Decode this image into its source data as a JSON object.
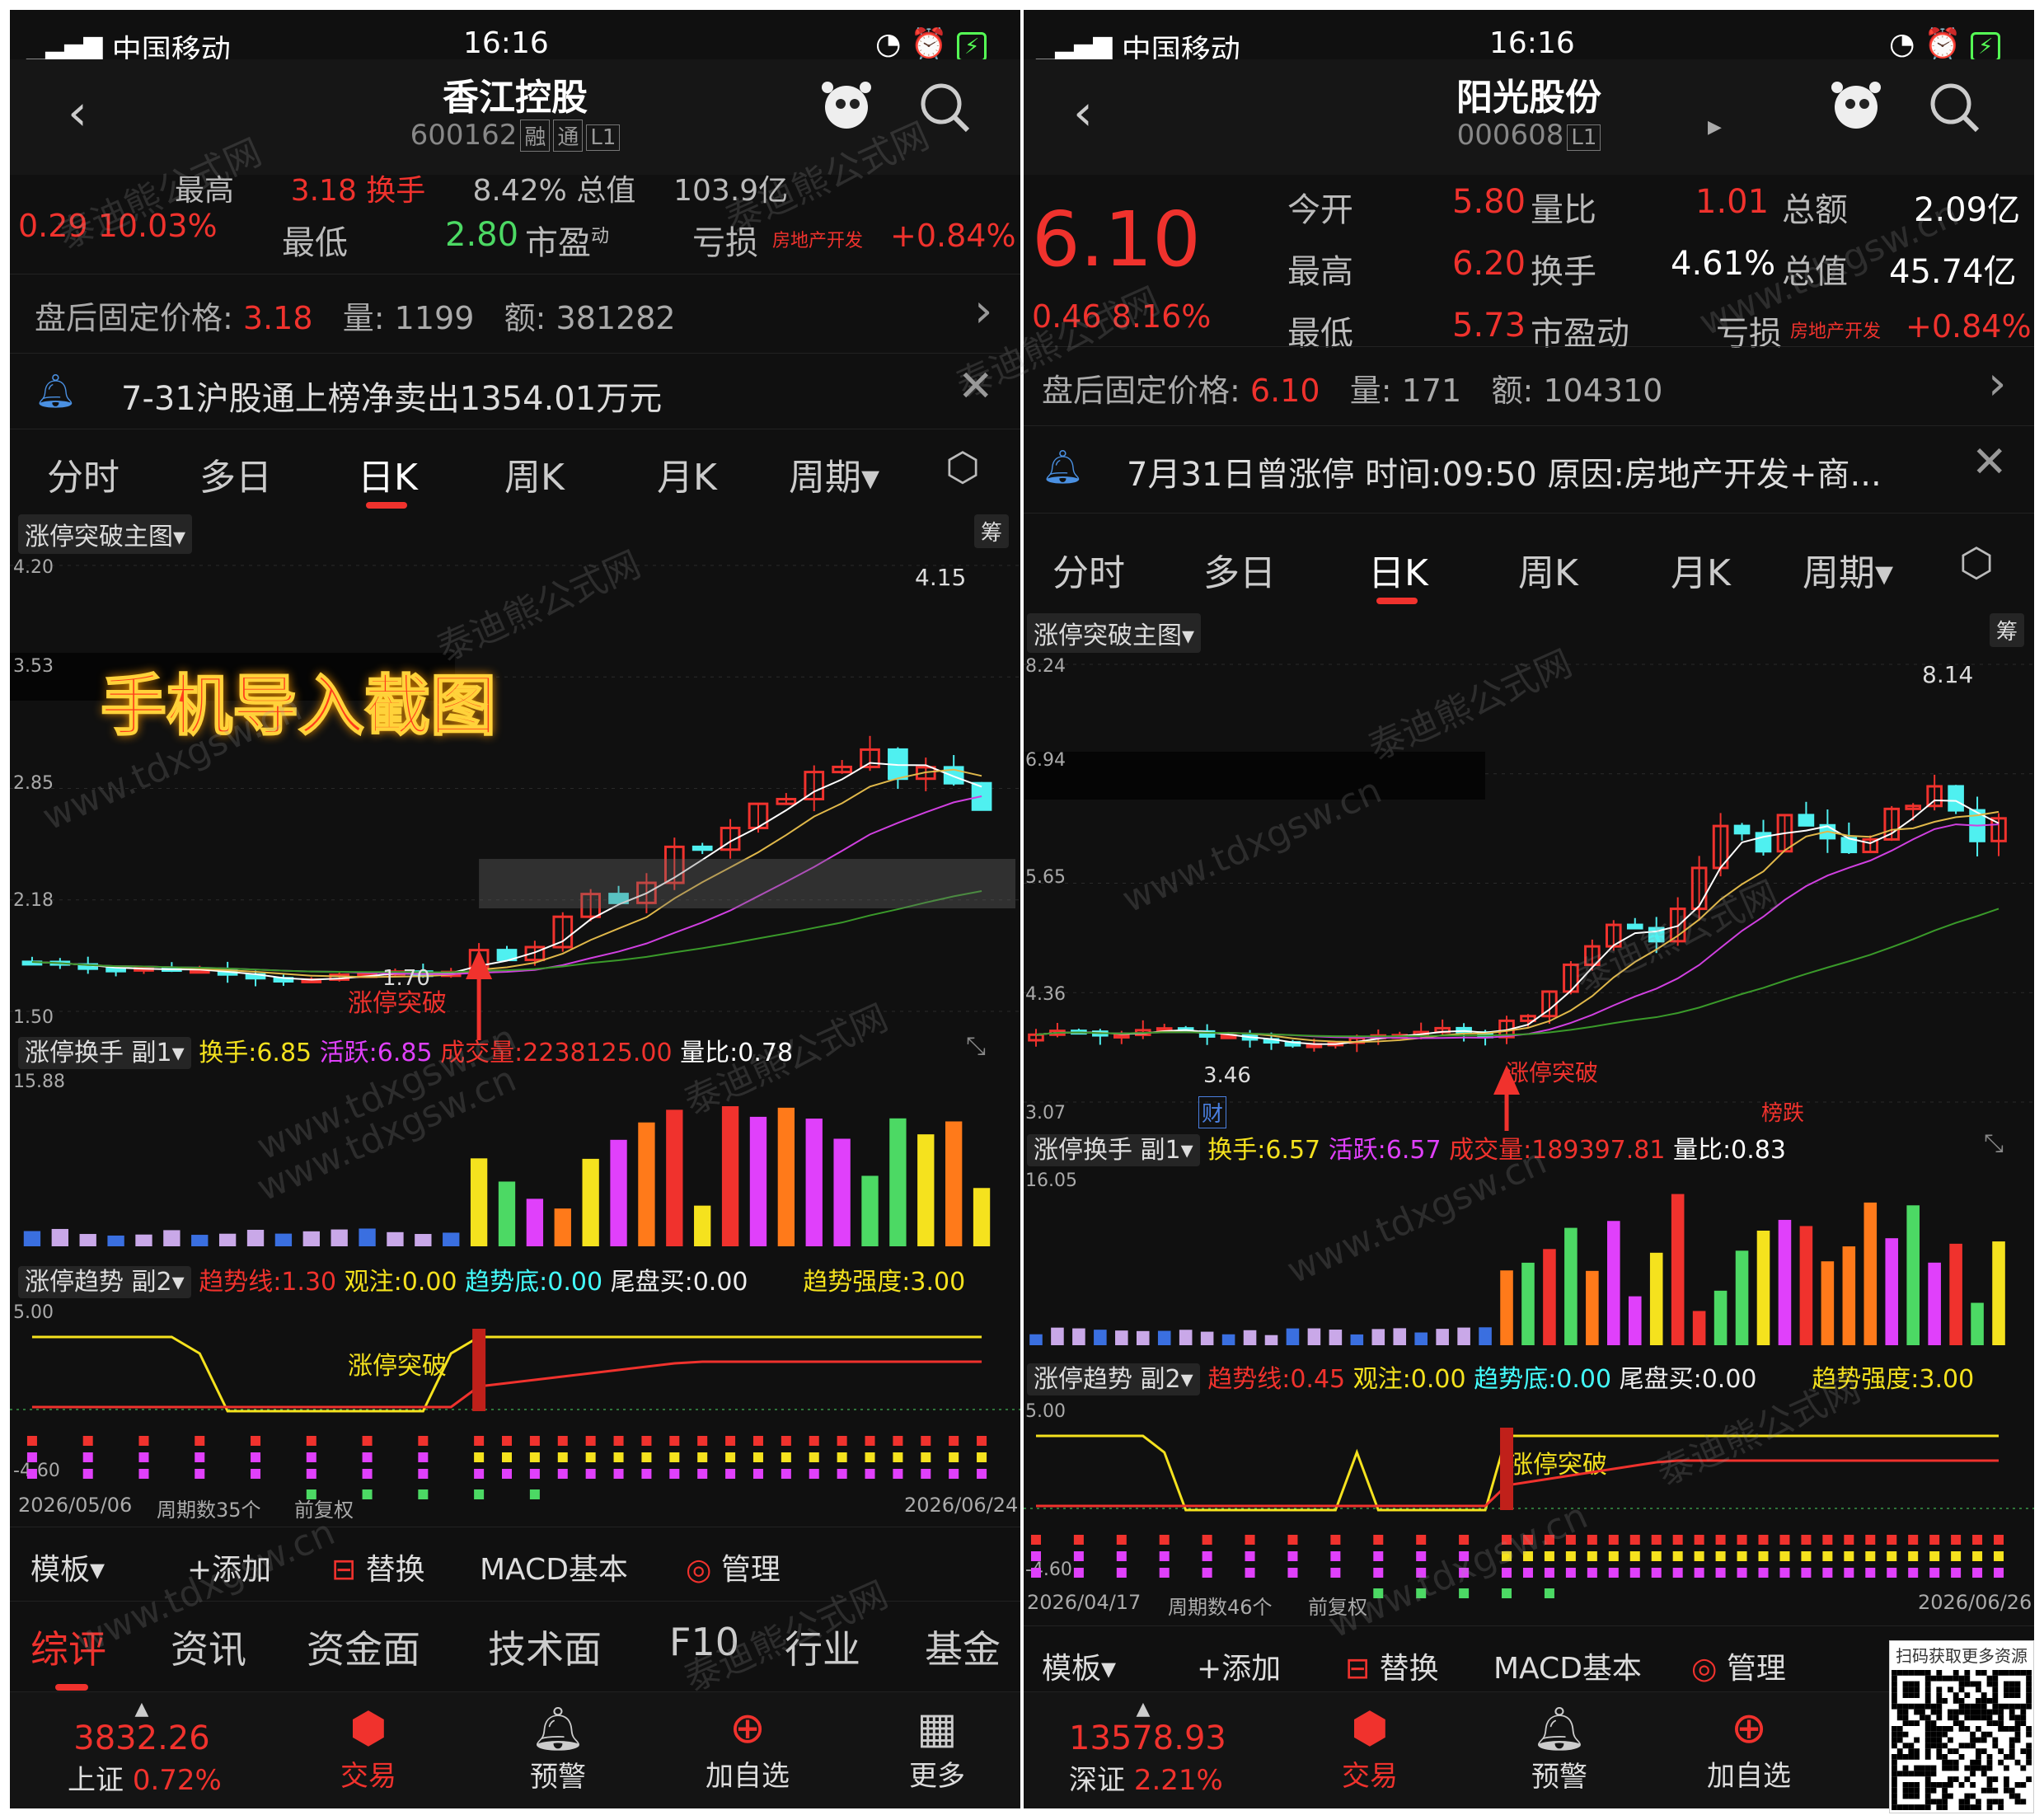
{
  "status": {
    "carrier": "中国移动",
    "time": "16:16"
  },
  "left": {
    "title": "香江控股",
    "code": "600162",
    "badges": [
      "融",
      "通",
      "L1"
    ],
    "cut_row": [
      "最高",
      "3.18 换手",
      "8.42% 总值",
      "103.9亿"
    ],
    "change": "0.29 10.03%",
    "low_label": "最低",
    "low_val": "2.80",
    "pe_label": "市盈",
    "pe_sup": "动",
    "loss": "亏损",
    "sector": "房地产开发",
    "sector_chg": "+0.84%",
    "after": {
      "label": "盘后固定价格:",
      "price": "3.18",
      "vol_label": "量:",
      "vol": "1199",
      "amt_label": "额:",
      "amt": "381282"
    },
    "notice": "7-31沪股通上榜净卖出1354.01万元",
    "tabs": [
      "分时",
      "多日",
      "日K",
      "周K",
      "月K",
      "周期▾"
    ],
    "main_label": "涨停突破主图▾",
    "chip": "筹",
    "yticks": [
      "4.20",
      "3.53",
      "2.85",
      "2.18",
      "1.50"
    ],
    "hi": "4.15",
    "lo": "1.70",
    "breakout": "涨停突破",
    "overlay": "手机导入截图",
    "sub1": {
      "name": "涨停换手 副1▾",
      "a": "换手:6.85",
      "b": "活跃:6.85",
      "c": "成交量:2238125.00",
      "d": "量比:0.78",
      "max": "15.88"
    },
    "sub2": {
      "name": "涨停趋势 副2▾",
      "a": "趋势线:1.30",
      "b": "观注:0.00",
      "c": "趋势底:0.00",
      "d": "尾盘买:0.00",
      "e": "趋势强度:3.00",
      "max": "5.00",
      "min": "-4.60",
      "label": "涨停突破"
    },
    "axis": {
      "start": "2026/05/06",
      "count": "周期数35个",
      "adj": "前复权",
      "end": "2026/06/24"
    },
    "tools": [
      "模板▾",
      "+添加",
      "替换",
      "MACD基本",
      "管理"
    ],
    "bottom_tabs": [
      "综评",
      "资讯",
      "资金面",
      "技术面",
      "F10",
      "行业",
      "基金"
    ],
    "index": {
      "val": "3832.26",
      "name": "上证",
      "chg": "0.72%"
    },
    "actions": [
      "交易",
      "预警",
      "加自选",
      "更多"
    ]
  },
  "right": {
    "title": "阳光股份",
    "code": "000608",
    "badges": [
      "L1"
    ],
    "price": "6.10",
    "change": "0.46 8.16%",
    "stats": [
      [
        "今开",
        "5.80",
        "量比",
        "1.01",
        "总额",
        "2.09亿"
      ],
      [
        "最高",
        "6.20",
        "换手",
        "4.61%",
        "总值",
        "45.74亿"
      ],
      [
        "最低",
        "5.73",
        "市盈动",
        "",
        "",
        ""
      ]
    ],
    "loss": "亏损",
    "sector": "房地产开发",
    "sector_chg": "+0.84%",
    "after": {
      "label": "盘后固定价格:",
      "price": "6.10",
      "vol_label": "量:",
      "vol": "171",
      "amt_label": "额:",
      "amt": "104310"
    },
    "notice": "7月31日曾涨停 时间:09:50 原因:房地产开发+商...",
    "tabs": [
      "分时",
      "多日",
      "日K",
      "周K",
      "月K",
      "周期▾"
    ],
    "main_label": "涨停突破主图▾",
    "chip": "筹",
    "yticks": [
      "8.24",
      "6.94",
      "5.65",
      "4.36",
      "3.07"
    ],
    "hi": "8.14",
    "lo": "3.46",
    "breakout": "涨停突破",
    "cai": "财",
    "bang": "榜跌",
    "sub1": {
      "name": "涨停换手 副1▾",
      "a": "换手:6.57",
      "b": "活跃:6.57",
      "c": "成交量:189397.81",
      "d": "量比:0.83",
      "max": "16.05"
    },
    "sub2": {
      "name": "涨停趋势 副2▾",
      "a": "趋势线:0.45",
      "b": "观注:0.00",
      "c": "趋势底:0.00",
      "d": "尾盘买:0.00",
      "e": "趋势强度:3.00",
      "max": "5.00",
      "min": "-4.60",
      "label": "涨停突破"
    },
    "axis": {
      "start": "2026/04/17",
      "count": "周期数46个",
      "adj": "前复权",
      "end": "2026/06/26"
    },
    "tools": [
      "模板▾",
      "+添加",
      "替换",
      "MACD基本",
      "管理"
    ],
    "index": {
      "val": "13578.93",
      "name": "深证",
      "chg": "2.21%"
    },
    "actions": [
      "交易",
      "预警",
      "加自选"
    ]
  },
  "qr": "扫码获取更多资源",
  "watermark": [
    "泰迪熊公式网",
    "www.tdxgsw.cn"
  ],
  "colors": {
    "up": "#f0322d",
    "down": "#4ff0f0",
    "ma5": "#ffffff",
    "ma10": "#e0b84a",
    "ma20": "#d040e0",
    "ma60": "#3a9a2a"
  },
  "chart_data": [
    {
      "type": "candlestick",
      "title": "涨停突破主图",
      "ylim": [
        1.5,
        4.2
      ],
      "yticks": [
        4.2,
        3.53,
        2.85,
        2.18,
        1.5
      ],
      "high": 4.15,
      "low": 1.7,
      "x_start": "2026/05/06",
      "x_end": "2026/06/24",
      "periods": 35
    },
    {
      "type": "candlestick",
      "title": "涨停突破主图",
      "ylim": [
        3.07,
        8.24
      ],
      "yticks": [
        8.24,
        6.94,
        5.65,
        4.36,
        3.07
      ],
      "high": 8.14,
      "low": 3.46,
      "x_start": "2026/04/17",
      "x_end": "2026/06/26",
      "periods": 46
    }
  ]
}
